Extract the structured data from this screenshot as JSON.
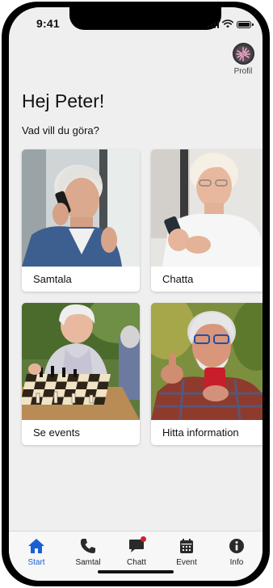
{
  "status_bar": {
    "time": "9:41"
  },
  "profile": {
    "label": "Profil",
    "icon": "profile-avatar"
  },
  "greeting": "Hej Peter!",
  "subtitle": "Vad vill du göra?",
  "cards": [
    {
      "label": "Samtala",
      "image": "senior-woman-on-phone"
    },
    {
      "label": "Chatta",
      "image": "senior-woman-texting"
    },
    {
      "label": "Se events",
      "image": "seniors-playing-chess"
    },
    {
      "label": "Hitta information",
      "image": "senior-man-thumbs-up-with-phone"
    }
  ],
  "tabs": [
    {
      "label": "Start",
      "icon": "home-icon",
      "active": true
    },
    {
      "label": "Samtal",
      "icon": "phone-icon"
    },
    {
      "label": "Chatt",
      "icon": "chat-icon",
      "badge": true
    },
    {
      "label": "Event",
      "icon": "calendar-icon"
    },
    {
      "label": "Info",
      "icon": "info-icon"
    }
  ],
  "colors": {
    "accent": "#1a5fd6",
    "background": "#efefef",
    "badge": "#d0202a"
  }
}
